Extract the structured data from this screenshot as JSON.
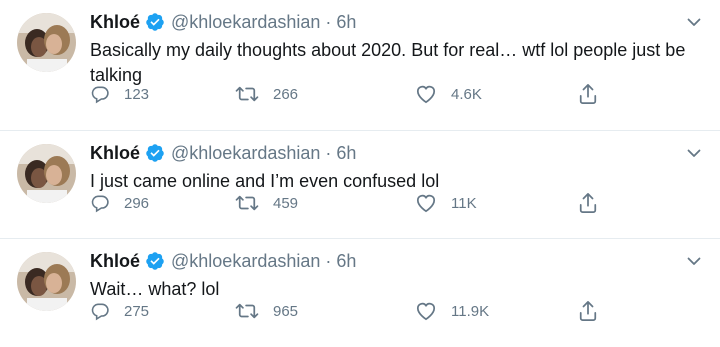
{
  "colors": {
    "verified": "#1da1f2",
    "secondary_text": "#657786",
    "divider": "#e6ecf0"
  },
  "tweets": [
    {
      "name": "Khloé",
      "handle": "@khloekardashian",
      "separator": "·",
      "time": "6h",
      "text": "Basically my daily thoughts about 2020. But for real… wtf lol people just be talking",
      "replies": "123",
      "retweets": "266",
      "likes": "4.6K"
    },
    {
      "name": "Khloé",
      "handle": "@khloekardashian",
      "separator": "·",
      "time": "6h",
      "text": "I just came online and I’m even confused lol",
      "replies": "296",
      "retweets": "459",
      "likes": "11K"
    },
    {
      "name": "Khloé",
      "handle": "@khloekardashian",
      "separator": "·",
      "time": "6h",
      "text": "Wait… what? lol",
      "replies": "275",
      "retweets": "965",
      "likes": "11.9K"
    }
  ],
  "icons": {
    "verified": "verified-badge-icon",
    "more": "chevron-down-icon",
    "reply": "reply-icon",
    "retweet": "retweet-icon",
    "like": "heart-icon",
    "share": "share-icon"
  }
}
